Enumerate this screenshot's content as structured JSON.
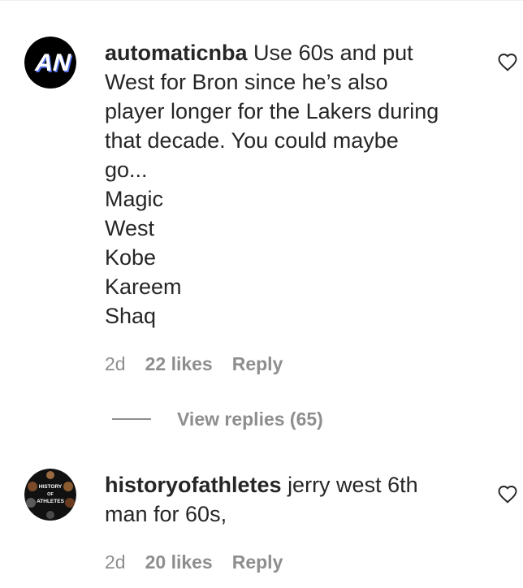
{
  "comments": [
    {
      "username": "automaticnba",
      "avatar_icon": "automaticnba-logo",
      "text_lines": [
        "Use 60s and put",
        "West for Bron since he’s also",
        "player longer for the Lakers during",
        "that decade. You could maybe",
        "go...",
        "Magic",
        "West",
        "Kobe",
        "Kareem",
        "Shaq"
      ],
      "time": "2d",
      "likes": "22 likes",
      "reply": "Reply",
      "view_replies": "View replies (65)"
    },
    {
      "username": "historyofathletes",
      "avatar_icon": "history-of-athletes-logo",
      "avatar_text": [
        "HISTORY",
        "OF",
        "ATHLETES"
      ],
      "text_lines": [
        "jerry west 6th",
        "man for 60s,"
      ],
      "time": "2d",
      "likes": "20 likes",
      "reply": "Reply"
    }
  ],
  "colors": {
    "primary_text": "#262626",
    "secondary_text": "#8e8e8e",
    "avatar_bg": "#000000"
  }
}
